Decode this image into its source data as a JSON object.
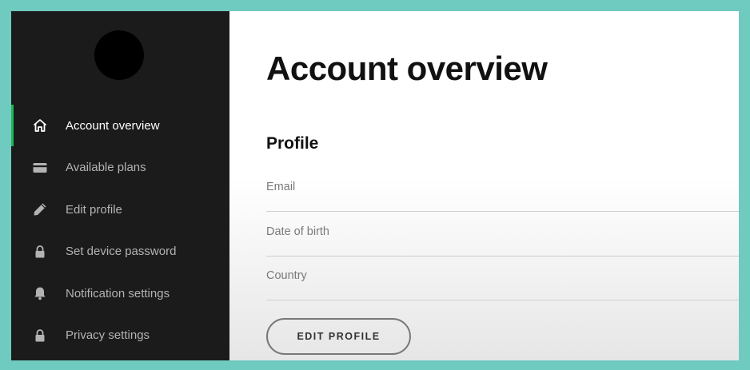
{
  "sidebar": {
    "items": [
      {
        "label": "Account overview",
        "icon": "home-icon",
        "active": true
      },
      {
        "label": "Available plans",
        "icon": "card-icon"
      },
      {
        "label": "Edit profile",
        "icon": "pencil-icon"
      },
      {
        "label": "Set device password",
        "icon": "lock-icon"
      },
      {
        "label": "Notification settings",
        "icon": "bell-icon"
      },
      {
        "label": "Privacy settings",
        "icon": "lock-icon"
      }
    ]
  },
  "main": {
    "title": "Account overview",
    "profile": {
      "heading": "Profile",
      "fields": [
        {
          "label": "Email"
        },
        {
          "label": "Date of birth"
        },
        {
          "label": "Country"
        }
      ],
      "edit_button": "EDIT PROFILE"
    }
  },
  "colors": {
    "accent": "#1db954",
    "sidebar_bg": "#1b1b1b",
    "frame_bg": "#6fcac0"
  }
}
